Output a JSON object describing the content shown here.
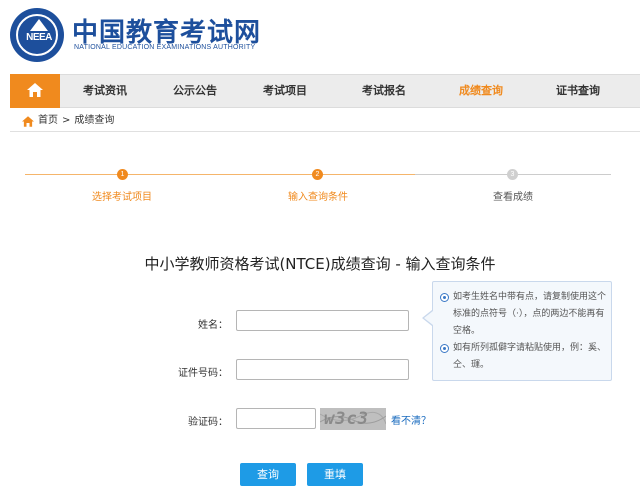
{
  "site": {
    "title_cn": "中国教育考试网",
    "title_en": "NATIONAL EDUCATION EXAMINATIONS AUTHORITY",
    "logo_text": "NEEA"
  },
  "nav": {
    "items": [
      {
        "label": "考试资讯",
        "active": false
      },
      {
        "label": "公示公告",
        "active": false
      },
      {
        "label": "考试项目",
        "active": false
      },
      {
        "label": "考试报名",
        "active": false
      },
      {
        "label": "成绩查询",
        "active": true
      },
      {
        "label": "证书查询",
        "active": false
      }
    ]
  },
  "breadcrumb": {
    "home": "首页",
    "separator": ">",
    "current": "成绩查询"
  },
  "steps": [
    {
      "number": "1",
      "label": "选择考试项目",
      "state": "done"
    },
    {
      "number": "2",
      "label": "输入查询条件",
      "state": "done"
    },
    {
      "number": "3",
      "label": "查看成绩",
      "state": "todo"
    }
  ],
  "form": {
    "title": "中小学教师资格考试(NTCE)成绩查询 - 输入查询条件",
    "name_label": "姓名：",
    "name_value": "",
    "id_label": "证件号码：",
    "id_value": "",
    "captcha_label": "验证码：",
    "captcha_value": "",
    "captcha_image_text": "w3c3",
    "refresh_label": "看不清？",
    "submit_label": "查询",
    "reset_label": "重填"
  },
  "tips": [
    "如考生姓名中带有点，请复制使用这个标准的点符号（·），点的两边不能再有空格。",
    "如有所列孤僻字请粘贴使用，例：奚、仝、璭。"
  ],
  "colors": {
    "brand_blue": "#1d4f9c",
    "accent_orange": "#f08a1e",
    "button_blue": "#1e9be6",
    "link_blue": "#1a6bbf"
  }
}
